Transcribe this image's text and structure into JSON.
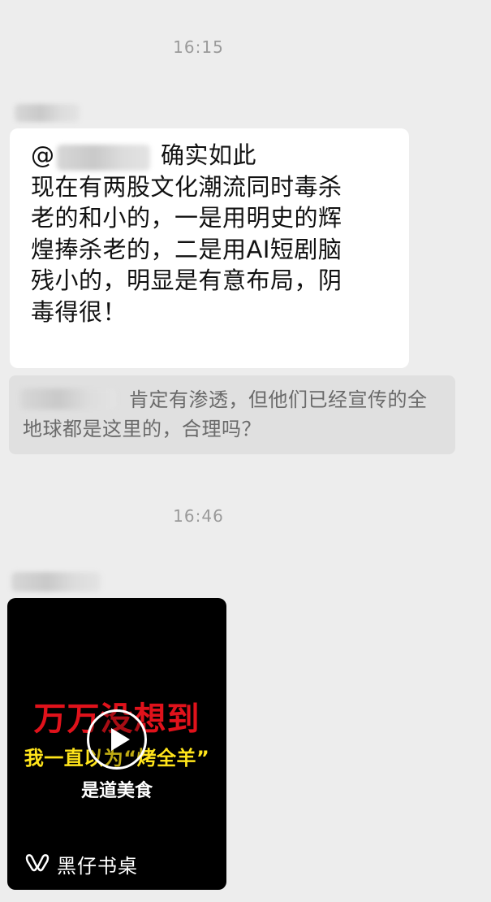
{
  "chat": {
    "time_1": "16:15",
    "message_1": {
      "at_prefix": "@",
      "first_line_tail": "确实如此",
      "body": "现在有两股文化潮流同时毒杀\n老的和小的，一是用明史的辉\n煌捧杀老的，二是用AI短剧脑\n残小的，明显是有意布局，阴\n毒得很！"
    },
    "quote": {
      "text": "肯定有渗透，但他们已经宣传的全地球都是这里的，合理吗？"
    },
    "time_2": "16:46",
    "video": {
      "headline": "万万没想到",
      "subtitle": "我一直以为“烤全羊”",
      "subtitle2": "是道美食",
      "channel_name": "黑仔书桌",
      "channel_icon": "channels-logo-icon",
      "play_icon": "play-icon"
    }
  },
  "colors": {
    "background": "#ededed",
    "bubble": "#ffffff",
    "quote_bg": "#e0e0e0",
    "headline_red": "#e0121b",
    "subtitle_yellow": "#ffe41a"
  }
}
